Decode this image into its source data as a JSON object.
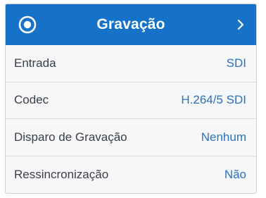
{
  "header": {
    "title": "Gravação",
    "icon": "record-icon",
    "chevron_icon": "chevron-right-icon",
    "accent_color": "#1572c8"
  },
  "rows": [
    {
      "label": "Entrada",
      "value": "SDI"
    },
    {
      "label": "Codec",
      "value": "H.264/5 SDI"
    },
    {
      "label": "Disparo de Gravação",
      "value": "Nenhum"
    },
    {
      "label": "Ressincronização",
      "value": "Não"
    }
  ]
}
